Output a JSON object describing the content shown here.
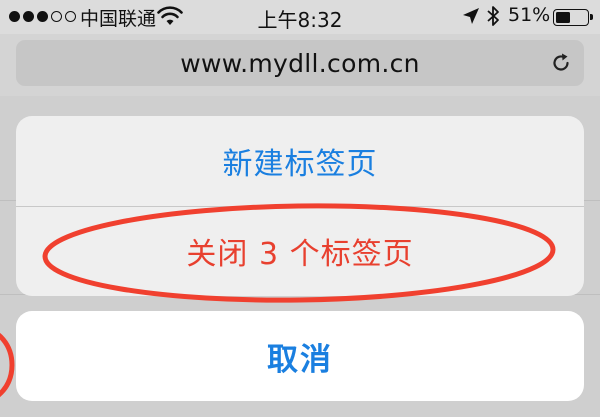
{
  "status_bar": {
    "carrier": "中国联通",
    "time": "上午8:32",
    "battery_percent": "51%",
    "battery_level": 0.51,
    "signal_strength": 3,
    "icons": [
      "signal-dots-icon",
      "wifi-icon",
      "location-arrow-icon",
      "bluetooth-icon",
      "battery-icon"
    ]
  },
  "address_bar": {
    "url": "www.mydll.com.cn",
    "reload_icon": "reload-icon"
  },
  "action_sheet": {
    "new_tab_label": "新建标签页",
    "close_tabs_label": "关闭 3 个标签页",
    "cancel_label": "取消"
  },
  "colors": {
    "ios_blue": "#1a7fe0",
    "destructive_red": "#e8402f",
    "annotation_red": "#f0402f"
  }
}
